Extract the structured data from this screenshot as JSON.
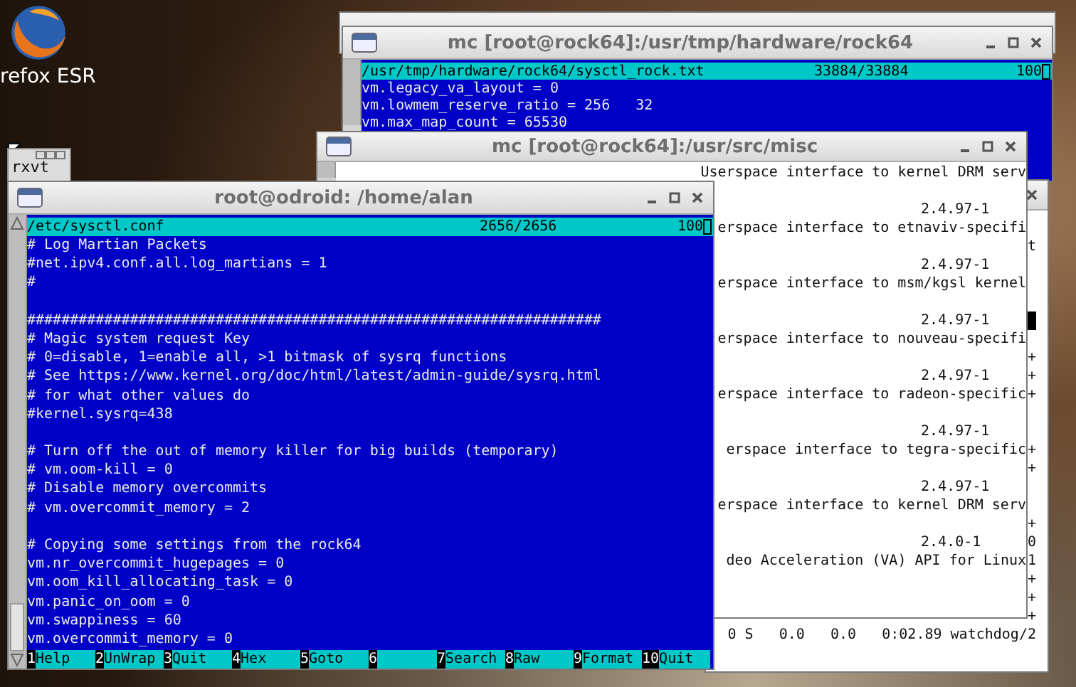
{
  "desktop": {
    "icon_label": "refox ESR",
    "minimized_window": "rxvt"
  },
  "hardware_viewer": {
    "title": "mc [root@rock64]:/usr/tmp/hardware/rock64",
    "file": "/usr/tmp/hardware/rock64/sysctl_rock.txt",
    "position": "33884/33884",
    "percent": "100",
    "lines": [
      "vm.legacy_va_layout = 0",
      "vm.lowmem_reserve_ratio = 256   32",
      "vm.max_map_count = 65530"
    ]
  },
  "process_monitor": {
    "rows": [
      {
        "kind": "blank"
      },
      {
        "kind": "text",
        "text": "t"
      },
      {
        "kind": "blank"
      },
      {
        "kind": "blank"
      },
      {
        "kind": "blank"
      },
      {
        "kind": "highlight"
      },
      {
        "kind": "blank"
      },
      {
        "kind": "text",
        "text": "+"
      },
      {
        "kind": "text",
        "text": "+"
      },
      {
        "kind": "text",
        "text": "+"
      },
      {
        "kind": "blank"
      },
      {
        "kind": "blank"
      },
      {
        "kind": "text",
        "text": "+"
      },
      {
        "kind": "text",
        "text": "+"
      },
      {
        "kind": "blank"
      },
      {
        "kind": "blank"
      },
      {
        "kind": "text",
        "text": "+"
      },
      {
        "kind": "text",
        "text": "0"
      },
      {
        "kind": "text",
        "text": "1"
      },
      {
        "kind": "text",
        "text": "+"
      },
      {
        "kind": "text",
        "text": "+"
      },
      {
        "kind": "text",
        "text": "+"
      },
      {
        "kind": "text",
        "text": "0 S   0.0   0.0   0:02.89 watchdog/2"
      }
    ]
  },
  "package_list": {
    "title": "mc [root@rock64]:/usr/src/misc",
    "packages": [
      {
        "description": "Userspace interface to kernel DRM serv"
      },
      {
        "version": "2.4.97-1",
        "description": "erspace interface to etnaviv-specifi"
      },
      {
        "version": "2.4.97-1",
        "description": "erspace interface to msm/kgsl kernel"
      },
      {
        "version": "2.4.97-1",
        "description": "erspace interface to nouveau-specifi"
      },
      {
        "version": "2.4.97-1",
        "description": "erspace interface to radeon-specific"
      },
      {
        "version": "2.4.97-1",
        "description": "erspace interface to tegra-specific"
      },
      {
        "version": "2.4.97-1",
        "description": "erspace interface to kernel DRM serv"
      },
      {
        "version": "2.4.0-1",
        "description": "deo Acceleration (VA) API for Linux"
      }
    ]
  },
  "sysctl_viewer": {
    "title": "root@odroid: /home/alan",
    "file": "/etc/sysctl.conf",
    "position": "2656/2656",
    "percent": "100",
    "blocks": [
      [
        "# Log Martian Packets",
        "#net.ipv4.conf.all.log_martians = 1",
        "#"
      ],
      [
        "###################################################################",
        "# Magic system request Key",
        "# 0=disable, 1=enable all, >1 bitmask of sysrq functions",
        "# See https://www.kernel.org/doc/html/latest/admin-guide/sysrq.html",
        "# for what other values do",
        "#kernel.sysrq=438"
      ],
      [
        "# Turn off the out of memory killer for big builds (temporary)",
        "# vm.oom-kill = 0",
        "# Disable memory overcommits",
        "# vm.overcommit_memory = 2"
      ],
      [
        "# Copying some settings from the rock64",
        "vm.nr_overcommit_hugepages = 0",
        "vm.oom_kill_allocating_task = 0",
        "vm.panic_on_oom = 0",
        "vm.swappiness = 60",
        "vm.overcommit_memory = 0"
      ]
    ],
    "function_keys": [
      {
        "number": "1",
        "label": "Help"
      },
      {
        "number": "2",
        "label": "UnWrap"
      },
      {
        "number": "3",
        "label": "Quit"
      },
      {
        "number": "4",
        "label": "Hex"
      },
      {
        "number": "5",
        "label": "Goto"
      },
      {
        "number": "6"
      },
      {
        "number": "7",
        "label": "Search"
      },
      {
        "number": "8",
        "label": "Raw"
      },
      {
        "number": "9",
        "label": "Format"
      },
      {
        "number": "10",
        "label": "Quit"
      }
    ]
  }
}
